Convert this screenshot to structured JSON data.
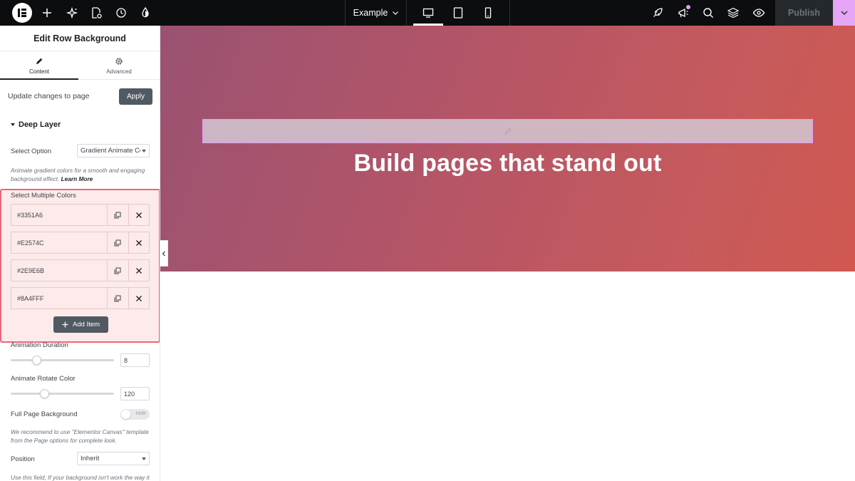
{
  "topbar": {
    "document_name": "Example",
    "publish_label": "Publish",
    "icons": [
      "elementor-logo-icon",
      "add-icon",
      "ai-sparkle-icon",
      "page-settings-icon",
      "history-icon",
      "site-settings-icon",
      "desktop-icon",
      "tablet-icon",
      "mobile-icon",
      "rocket-icon",
      "whats-new-icon",
      "search-icon",
      "structure-icon",
      "preview-icon"
    ],
    "accent_color": "#E89CF8"
  },
  "panel": {
    "title": "Edit Row Background",
    "tabs": [
      {
        "label": "Content",
        "icon": "pencil-icon",
        "active": true
      },
      {
        "label": "Advanced",
        "icon": "gear-icon",
        "active": false
      }
    ],
    "update_label": "Update changes to page",
    "apply_label": "Apply",
    "section_title": "Deep Layer",
    "select_option": {
      "label": "Select Option",
      "value": "Gradient Animate Cc"
    },
    "select_desc": "Animate gradient colors for a smooth and engaging background effect.",
    "learn_more": "Learn More",
    "colors_label": "Select Multiple Colors",
    "colors": [
      "#3351A6",
      "#E2574C",
      "#2E9E6B",
      "#8A4FFF"
    ],
    "add_item_label": "Add Item",
    "animation_duration": {
      "label": "Animation Duration",
      "value": "8",
      "fraction": 0.25
    },
    "animate_rotate": {
      "label": "Animate Rotate Color",
      "value": "120",
      "fraction": 0.33
    },
    "full_page": {
      "label": "Full Page Background",
      "toggle": "Hide"
    },
    "full_page_desc": "We recommend to use \"Elementor Canvas\" template from the Page options for complete look.",
    "position": {
      "label": "Position",
      "value": "Inherit"
    },
    "position_desc": "Use this field, If your background isn't work the way it"
  },
  "canvas": {
    "headline": "Build pages that stand out",
    "gradient_colors": [
      "#9A5272",
      "#D05850"
    ]
  }
}
